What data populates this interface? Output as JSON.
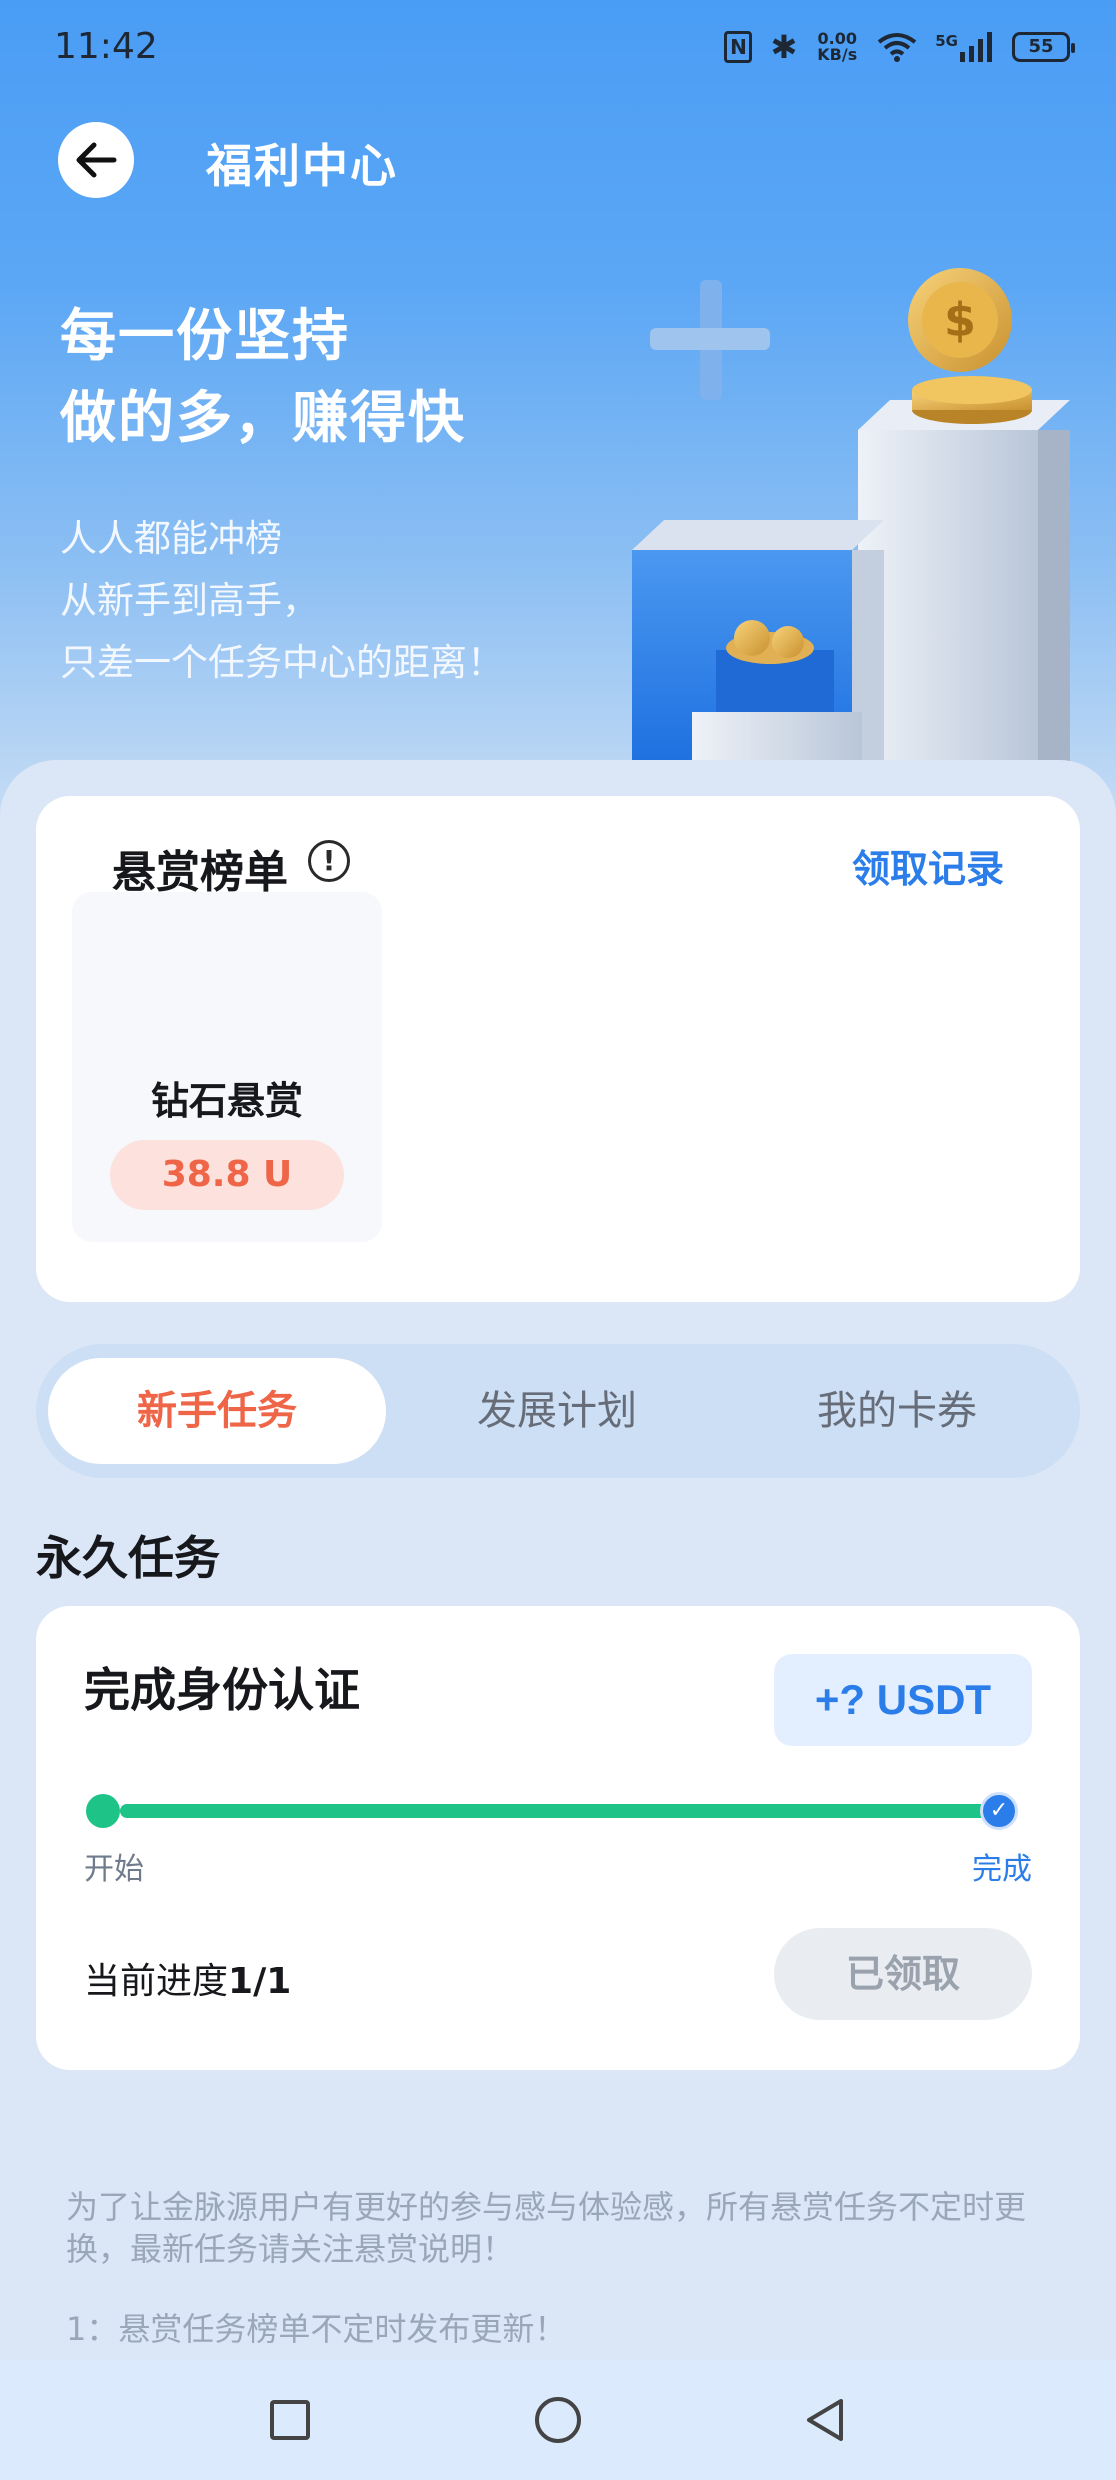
{
  "status_bar": {
    "time": "11:42",
    "network_speed": "0.00\nKB/s",
    "network_type": "5G",
    "battery": "55"
  },
  "header": {
    "title": "福利中心"
  },
  "hero": {
    "headline_line1": "每一份坚持",
    "headline_line2": "做的多，赚得快",
    "sub_line1": "人人都能冲榜",
    "sub_line2": "从新手到高手，",
    "sub_line3": "只差一个任务中心的距离！"
  },
  "bounty": {
    "title": "悬赏榜单",
    "record_link": "领取记录",
    "rewards": [
      {
        "name": "钻石悬赏",
        "amount": "38.8 U"
      }
    ]
  },
  "tabs": [
    {
      "label": "新手任务",
      "active": true
    },
    {
      "label": "发展计划",
      "active": false
    },
    {
      "label": "我的卡券",
      "active": false
    }
  ],
  "section": {
    "heading": "永久任务"
  },
  "task": {
    "title": "完成身份认证",
    "reward": "+? USDT",
    "start_label": "开始",
    "end_label": "完成",
    "progress_label": "当前进度",
    "progress_value": "1/1",
    "progress_fraction": 1.0,
    "button_label": "已领取"
  },
  "notes": {
    "intro": "为了让金脉源用户有更好的参与感与体验感，所有悬赏任务不定时更换，最新任务请关注悬赏说明！",
    "item1": "1：悬赏任务榜单不定时发布更新！"
  },
  "colors": {
    "accent_blue": "#2b7de9",
    "accent_orange": "#ef6548",
    "progress_green": "#1ec388"
  }
}
